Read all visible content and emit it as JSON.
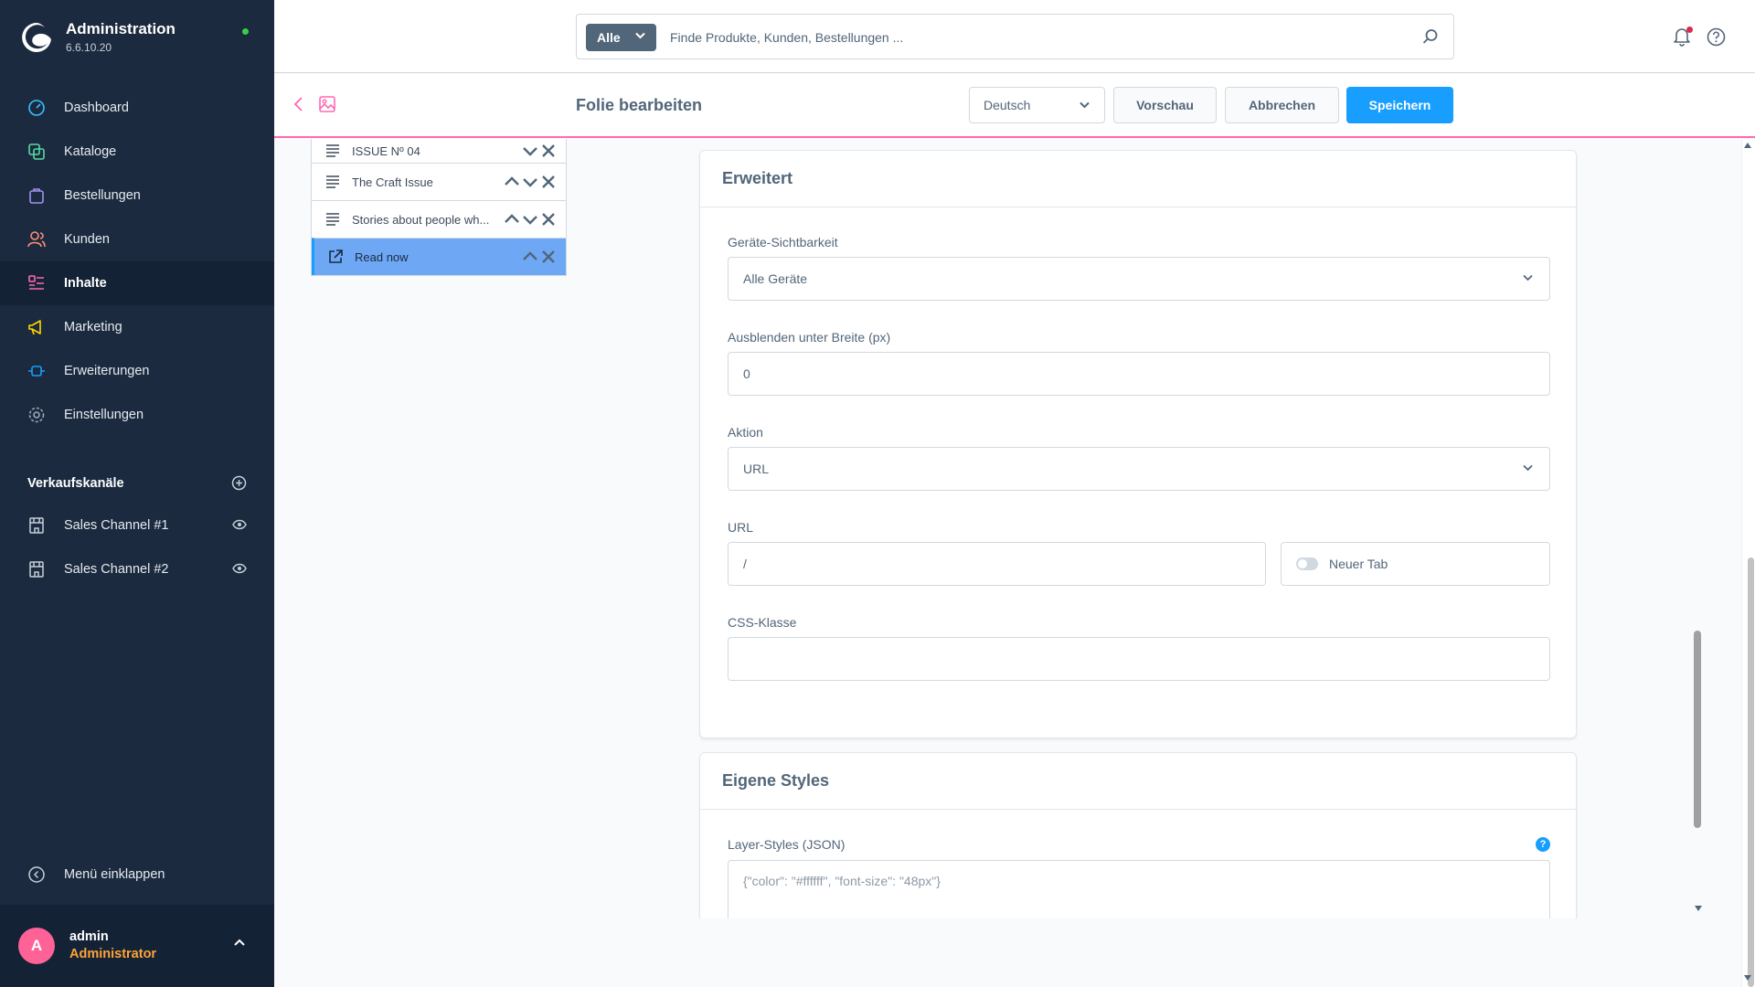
{
  "brand": {
    "title": "Administration",
    "version": "6.6.10.20"
  },
  "nav": [
    {
      "label": "Dashboard",
      "icon": "dashboard-icon"
    },
    {
      "label": "Kataloge",
      "icon": "catalog-icon"
    },
    {
      "label": "Bestellungen",
      "icon": "orders-icon"
    },
    {
      "label": "Kunden",
      "icon": "customers-icon"
    },
    {
      "label": "Inhalte",
      "icon": "content-icon",
      "active": true
    },
    {
      "label": "Marketing",
      "icon": "marketing-icon"
    },
    {
      "label": "Erweiterungen",
      "icon": "extensions-icon"
    },
    {
      "label": "Einstellungen",
      "icon": "settings-icon"
    }
  ],
  "sales_channels": {
    "heading": "Verkaufskanäle",
    "items": [
      {
        "label": "Sales Channel #1"
      },
      {
        "label": "Sales Channel #2"
      }
    ]
  },
  "collapse_label": "Menü einklappen",
  "user": {
    "initial": "A",
    "name": "admin",
    "role": "Administrator"
  },
  "search": {
    "type": "Alle",
    "placeholder": "Finde Produkte, Kunden, Bestellungen ..."
  },
  "smartbar": {
    "title": "Folie bearbeiten",
    "language": "Deutsch",
    "preview": "Vorschau",
    "cancel": "Abbrechen",
    "save": "Speichern"
  },
  "elements": [
    {
      "label": "ISSUE Nº 04",
      "icon": "text-icon",
      "up": false
    },
    {
      "label": "The Craft Issue",
      "icon": "text-icon",
      "up": true
    },
    {
      "label": "Stories about people wh...",
      "icon": "text-icon",
      "up": true
    },
    {
      "label": "Read now",
      "icon": "external-link-icon",
      "up": true,
      "active": true
    }
  ],
  "advanced": {
    "title": "Erweitert",
    "visibility_label": "Geräte-Sichtbarkeit",
    "visibility_value": "Alle Geräte",
    "hide_label": "Ausblenden unter Breite (px)",
    "hide_value": "0",
    "action_label": "Aktion",
    "action_value": "URL",
    "url_label": "URL",
    "url_value": "/",
    "new_tab_label": "Neuer Tab",
    "css_label": "CSS-Klasse",
    "css_value": ""
  },
  "custom_styles": {
    "title": "Eigene Styles",
    "layer_label": "Layer-Styles (JSON)",
    "help": "?",
    "layer_placeholder": "{\"color\": \"#ffffff\", \"font-size\": \"48px\"}"
  },
  "colors": {
    "sidebar": "#1b2a3e",
    "primary": "#189eff",
    "accent_line": "#ff68b4",
    "active_element": "#6ea8f5",
    "avatar": "#ff6296",
    "role": "#ffa336"
  }
}
